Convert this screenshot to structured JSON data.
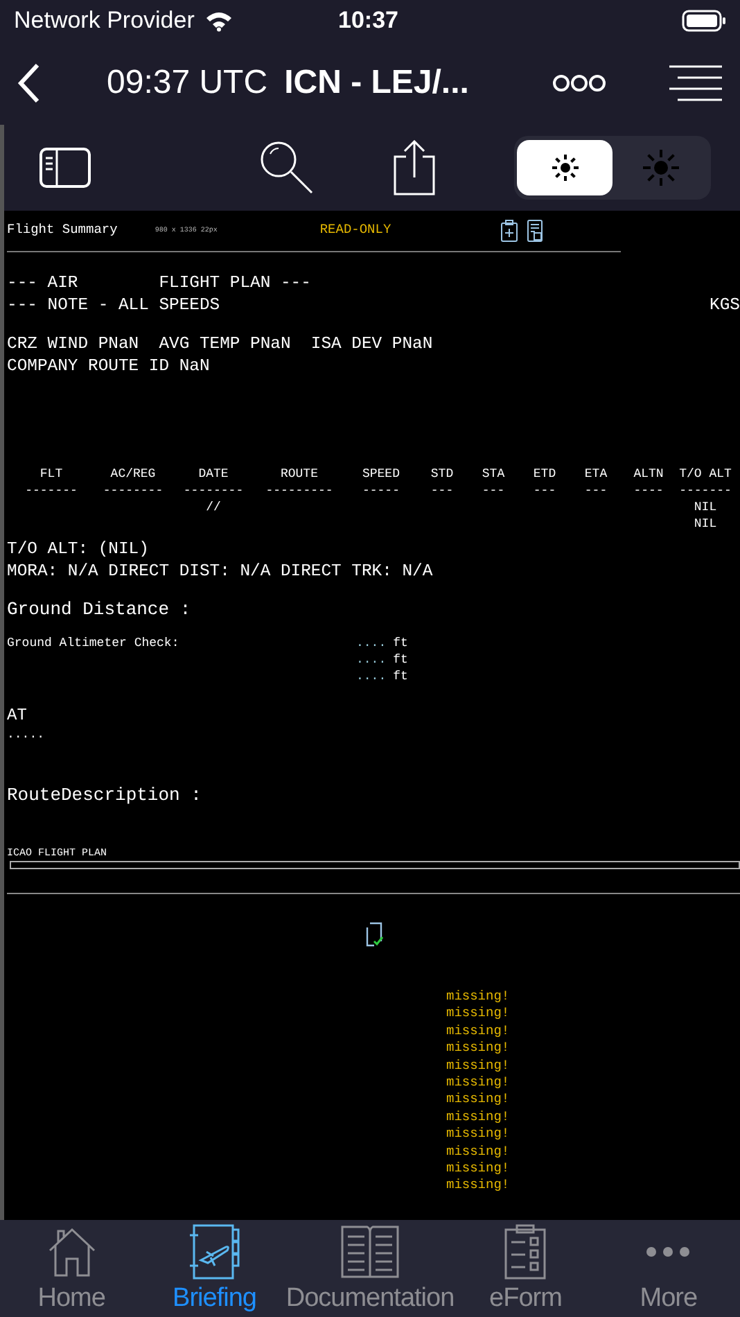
{
  "status_bar": {
    "carrier": "Network Provider",
    "time": "10:37"
  },
  "nav": {
    "time": "09:37 UTC",
    "route": "ICN - LEJ/..."
  },
  "toolbar": {
    "brightness": [
      {
        "kind": "dim",
        "selected": true
      },
      {
        "kind": "bright",
        "selected": false
      }
    ]
  },
  "document": {
    "title": "Flight Summary",
    "size": "980 x 1336 22px",
    "badge": "READ-ONLY",
    "header_lines": [
      "--- AIR        FLIGHT PLAN ---",
      "--- NOTE - ALL SPEEDS"
    ],
    "header_right": "KGS",
    "info_lines": [
      "CRZ WIND PNaN  AVG TEMP PNaN  ISA DEV PNaN",
      "COMPANY ROUTE ID NaN"
    ],
    "table": {
      "columns": [
        {
          "heading": "FLT",
          "rule": "-------"
        },
        {
          "heading": "AC/REG",
          "rule": "--------"
        },
        {
          "heading": "DATE",
          "rule": "--------",
          "cells": [
            "//"
          ]
        },
        {
          "heading": "ROUTE",
          "rule": "---------"
        },
        {
          "heading": "SPEED",
          "rule": "-----"
        },
        {
          "heading": "STD",
          "rule": "---"
        },
        {
          "heading": "STA",
          "rule": "---"
        },
        {
          "heading": "ETD",
          "rule": "---"
        },
        {
          "heading": "ETA",
          "rule": "---"
        },
        {
          "heading": "ALTN",
          "rule": "----"
        },
        {
          "heading": "T/O ALT",
          "rule": "-------",
          "cells": [
            "NIL",
            "NIL"
          ]
        }
      ]
    },
    "alt_lines": [
      "T/O ALT: (NIL)",
      "MORA: N/A DIRECT DIST: N/A DIRECT TRK: N/A"
    ],
    "ground_distance": "Ground Distance :",
    "altimeter_label": "Ground Altimeter Check:",
    "altimeter_values": [
      {
        "dots": "....",
        "unit": "ft"
      },
      {
        "dots": "....",
        "unit": "ft"
      },
      {
        "dots": "....",
        "unit": "ft"
      }
    ],
    "atc_label": "AT",
    "atc_value": ".....",
    "route_description": "RouteDescription :",
    "icao_label": "ICAO FLIGHT PLAN",
    "missing": [
      "missing!",
      "missing!",
      "missing!",
      "missing!",
      "missing!",
      "missing!",
      "missing!",
      "missing!",
      "missing!",
      "missing!",
      "missing!",
      "missing!"
    ]
  },
  "tabs": [
    {
      "label": "Home",
      "selected": false
    },
    {
      "label": "Briefing",
      "selected": true
    },
    {
      "label": "Documentation",
      "selected": false
    },
    {
      "label": "eForm",
      "selected": false
    },
    {
      "label": "More",
      "selected": false
    }
  ]
}
